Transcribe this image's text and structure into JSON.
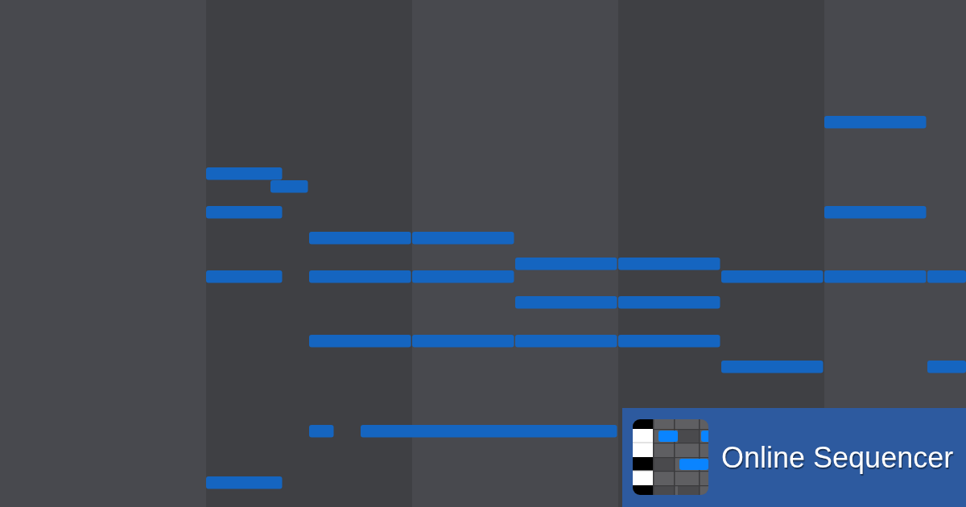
{
  "banner": {
    "title": "Online Sequencer"
  }
}
